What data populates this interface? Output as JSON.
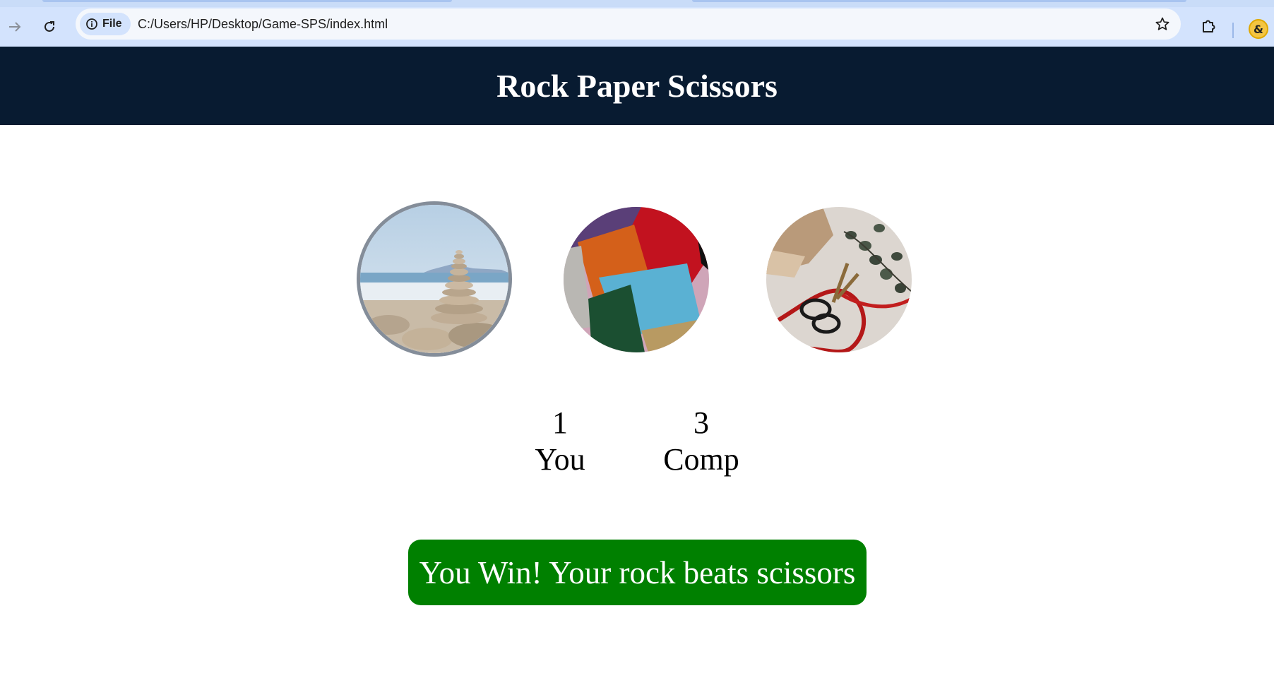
{
  "browser": {
    "url": "C:/Users/HP/Desktop/Game-SPS/index.html",
    "file_chip_label": "File",
    "profile_initial": "&"
  },
  "page": {
    "title": "Rock Paper Scissors"
  },
  "choices": [
    {
      "id": "rock",
      "icon": "rock-image",
      "selected": true
    },
    {
      "id": "paper",
      "icon": "paper-image",
      "selected": false
    },
    {
      "id": "scissors",
      "icon": "scissors-image",
      "selected": false
    }
  ],
  "scoreboard": {
    "user_score": "1",
    "user_label": "You",
    "comp_score": "3",
    "comp_label": "Comp"
  },
  "message": {
    "text": "You Win! Your rock beats scissors",
    "color": "#008000"
  },
  "colors": {
    "header_bg": "#081b31",
    "selected_ring": "#848d99"
  }
}
